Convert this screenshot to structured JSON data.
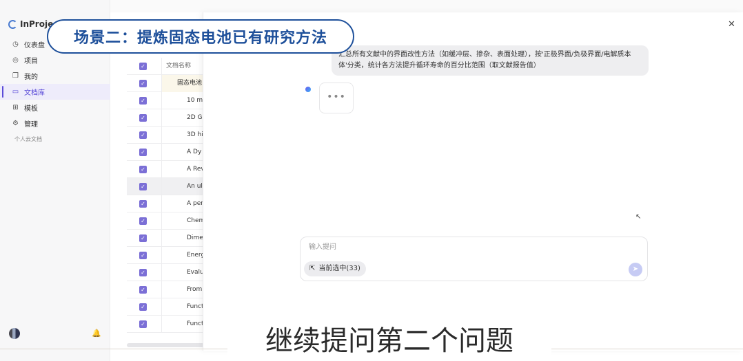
{
  "app": {
    "name": "InProject"
  },
  "sidebar": {
    "items": [
      {
        "label": "仪表盘",
        "icon": "dashboard-icon"
      },
      {
        "label": "项目",
        "icon": "project-icon"
      },
      {
        "label": "我的",
        "icon": "user-docs-icon"
      },
      {
        "label": "文档库",
        "icon": "folder-icon",
        "active": true
      },
      {
        "label": "模板",
        "icon": "template-icon"
      },
      {
        "label": "管理",
        "icon": "gear-icon"
      }
    ],
    "sub_label": "个人云文档"
  },
  "table": {
    "header": "文档名称",
    "group": "固态电池",
    "rows": [
      "10 m",
      "2D G",
      "3D hi",
      "A Dy",
      "A Rev",
      "An ul",
      "A per",
      "Chem",
      "Dime",
      "Energ",
      "Evalu",
      "From",
      "Funct",
      "Funct"
    ]
  },
  "chat": {
    "user_message": "汇总所有文献中的界面改性方法（如缓冲层、掺杂、表面处理），按'正极界面/负极界面/电解质本体'分类，统计各方法提升循环寿命的百分比范围（取文献报告值）",
    "typing": "•••",
    "input_placeholder": "输入提问",
    "selection_chip": "当前选中(33)"
  },
  "overlay": {
    "scene_title": "场景二：提炼固态电池已有研究方法",
    "caption": "继续提问第二个问题"
  },
  "colors": {
    "accent": "#5a4bd8",
    "scene_border": "#1d4f9a"
  }
}
